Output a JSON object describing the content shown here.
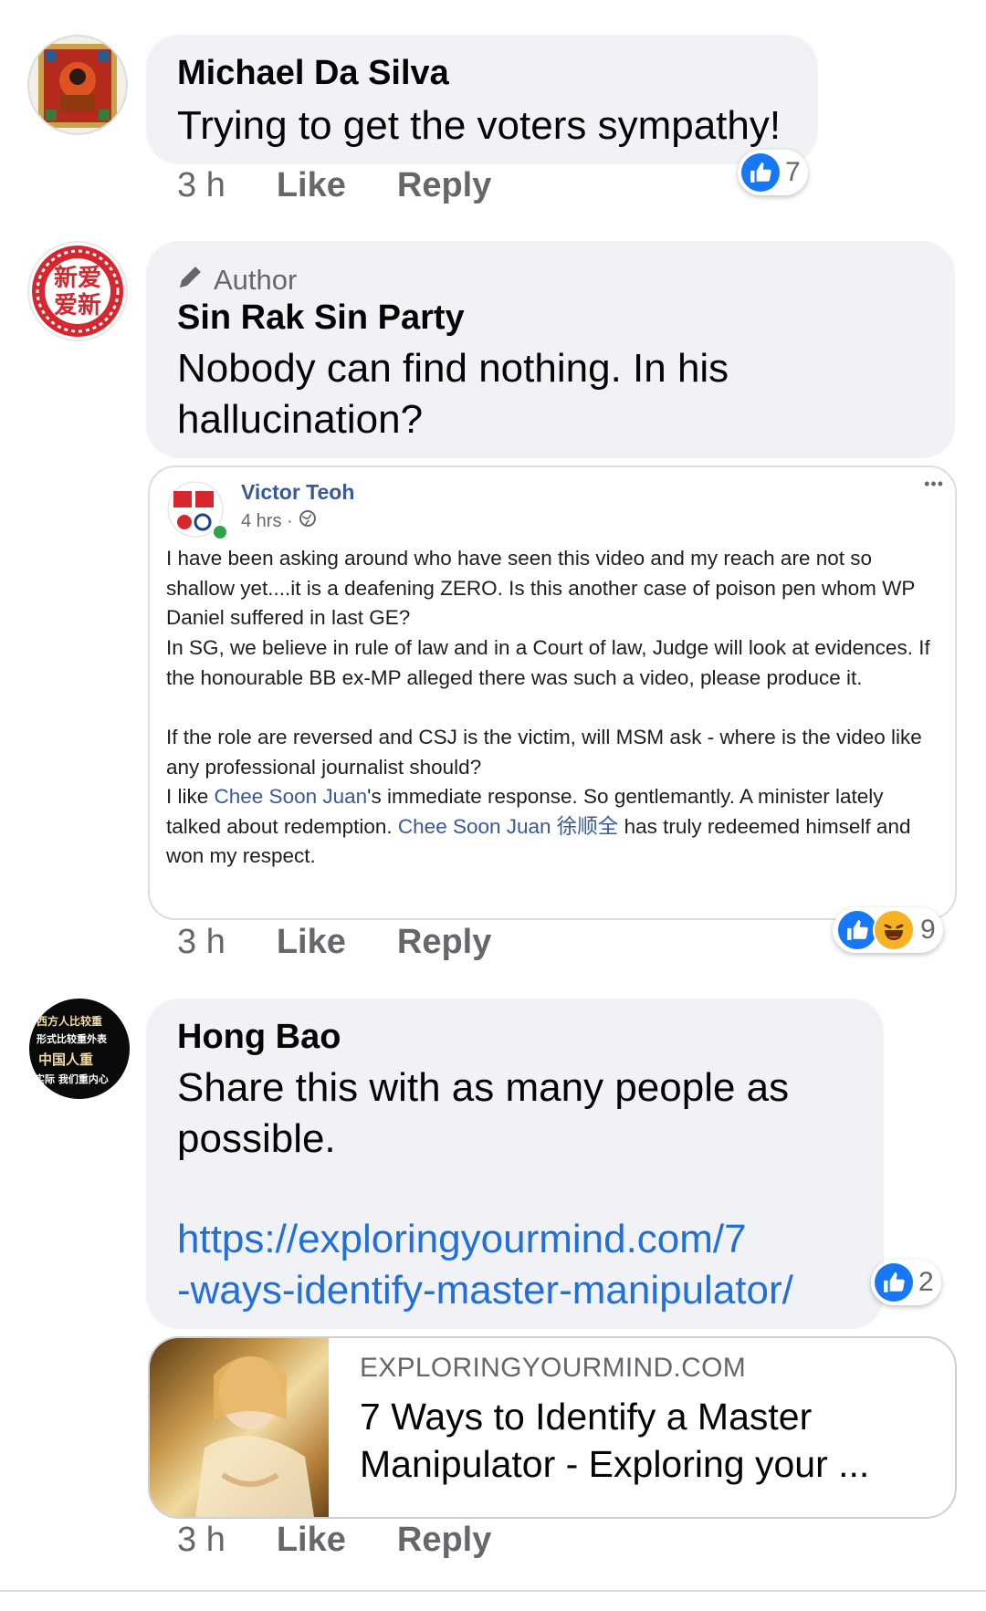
{
  "comments": [
    {
      "name": "Michael Da Silva",
      "text": "Trying to get the voters sympathy!",
      "time": "3 h",
      "like_label": "Like",
      "reply_label": "Reply",
      "reactions": {
        "types": [
          "like"
        ],
        "count": "7"
      }
    },
    {
      "author_badge": "Author",
      "name": "Sin Rak Sin Party",
      "avatar_text": [
        "新爱",
        "爱新"
      ],
      "text": "Nobody can find nothing. In his hallucination?",
      "time": "3 h",
      "like_label": "Like",
      "reply_label": "Reply",
      "reactions": {
        "types": [
          "like",
          "haha"
        ],
        "count": "9"
      },
      "shared_post": {
        "poster": "Victor Teoh",
        "meta": "4 hrs ·",
        "more": "•••",
        "p1": "I have been asking around who have seen this video and my reach are not so shallow yet....it is a deafening ZERO. Is this another case of poison pen whom WP Daniel suffered in last GE?",
        "p2": "In SG, we believe in rule of law and in a Court of law, Judge will look at evidences. If the honourable BB ex-MP alleged there was such a video, please produce it.",
        "p3": "If the role are reversed and CSJ is the victim, will MSM ask - where is the video like any professional journalist should?",
        "p4_a": "I like ",
        "p4_link1": "Chee Soon Juan",
        "p4_b": "'s immediate response. So gentlemantly. A minister lately talked about redemption. ",
        "p4_link2": "Chee Soon Juan 徐顺全",
        "p4_c": " has truly redeemed himself and won my respect."
      }
    },
    {
      "name": "Hong Bao",
      "avatar_lines": [
        "西方人比较重",
        "形式比较重外表",
        "中国人重",
        "实际 我们重内心"
      ],
      "text": "Share this with as many people as possible.",
      "link_line1": "https://exploringyourmind.com/7",
      "link_line2": "-ways-identify-master-manipulator/",
      "time": "3 h",
      "like_label": "Like",
      "reply_label": "Reply",
      "reactions": {
        "types": [
          "like"
        ],
        "count": "2"
      },
      "link_preview": {
        "domain": "EXPLORINGYOURMIND.COM",
        "title_line1": "7 Ways to Identify a Master",
        "title_line2": "Manipulator - Exploring your ..."
      }
    }
  ],
  "colors": {
    "bubble": "#f0f2f5",
    "like_blue": "#1877f2",
    "link_blue": "#385898",
    "url_blue": "#216fdb",
    "meta_gray": "#65676b"
  }
}
